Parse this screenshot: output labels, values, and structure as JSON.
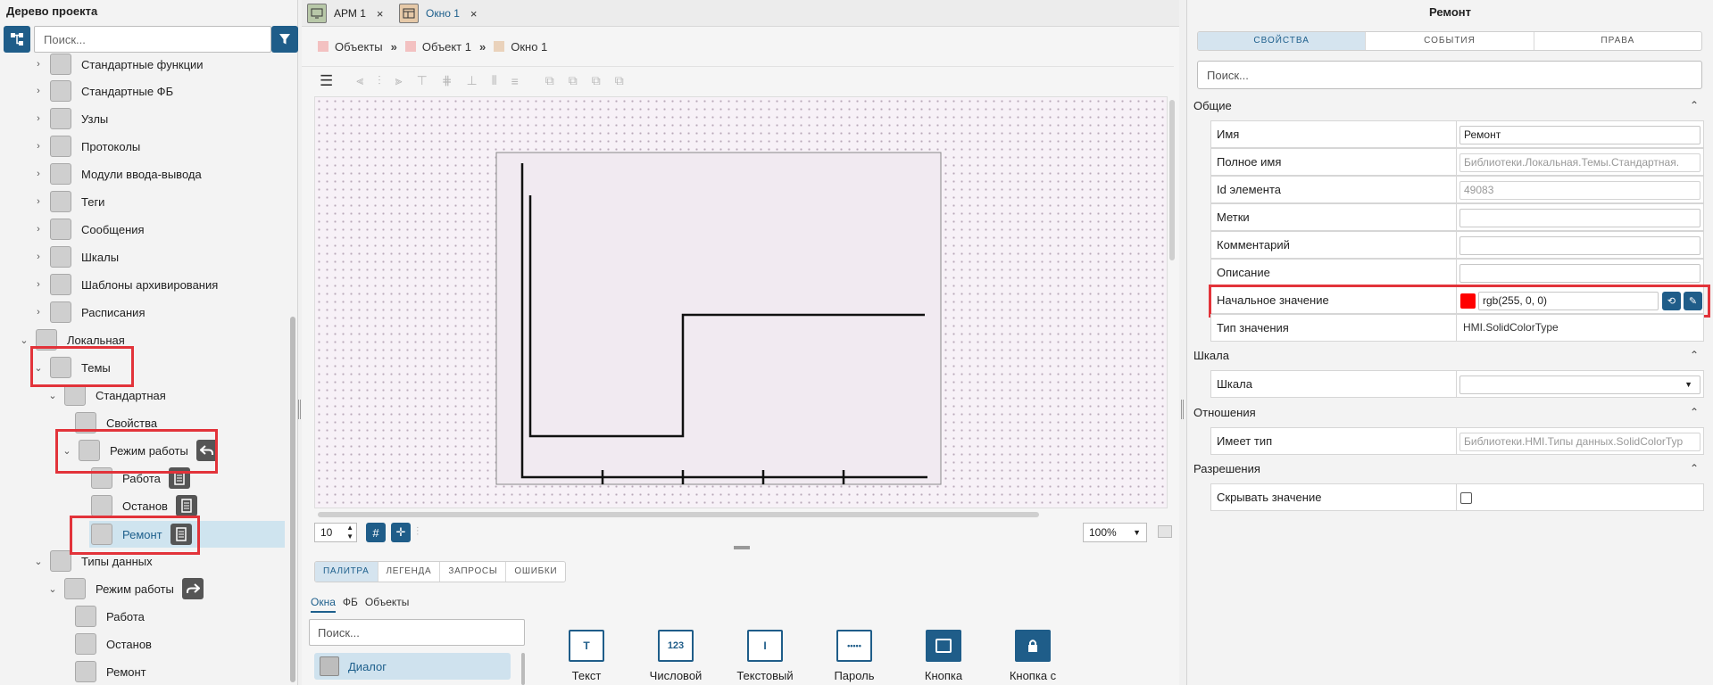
{
  "left": {
    "title": "Дерево проекта",
    "search_placeholder": "Поиск...",
    "tree": [
      {
        "label": "Стандартные функции"
      },
      {
        "label": "Стандартные ФБ"
      },
      {
        "label": "Узлы"
      },
      {
        "label": "Протоколы"
      },
      {
        "label": "Модули ввода-вывода"
      },
      {
        "label": "Теги"
      },
      {
        "label": "Сообщения"
      },
      {
        "label": "Шкалы"
      },
      {
        "label": "Шаблоны архивирования"
      },
      {
        "label": "Расписания"
      },
      {
        "label": "Локальная"
      },
      {
        "label": "Темы"
      },
      {
        "label": "Стандартная"
      },
      {
        "label": "Свойства"
      },
      {
        "label": "Режим работы"
      },
      {
        "label": "Работа"
      },
      {
        "label": "Останов"
      },
      {
        "label": "Ремонт"
      },
      {
        "label": "Типы данных"
      },
      {
        "label": "Режим работы"
      },
      {
        "label": "Работа"
      },
      {
        "label": "Останов"
      },
      {
        "label": "Ремонт"
      }
    ]
  },
  "center": {
    "tabs": [
      {
        "label": "АРМ 1",
        "close": "×"
      },
      {
        "label": "Окно 1",
        "close": "×"
      }
    ],
    "breadcrumb": {
      "items": [
        "Объекты",
        "Объект 1",
        "Окно 1"
      ],
      "separator": "»"
    },
    "grid_size": "10",
    "zoom": "100%",
    "panel_tabs": [
      "ПАЛИТРА",
      "ЛЕГЕНДА",
      "ЗАПРОСЫ",
      "ОШИБКИ"
    ],
    "sub_tabs": [
      "Окна",
      "ФБ",
      "Объекты"
    ],
    "palette_search_placeholder": "Поиск...",
    "palette_list_item": "Диалог",
    "palette_items": [
      {
        "label": "Текст",
        "icon": "T"
      },
      {
        "label": "Числовой",
        "icon": "123"
      },
      {
        "label": "Текстовый",
        "icon": "I"
      },
      {
        "label": "Пароль",
        "icon": "•••••"
      },
      {
        "label": "Кнопка",
        "icon": ""
      },
      {
        "label": "Кнопка с",
        "icon": "lock"
      }
    ]
  },
  "right": {
    "title": "Ремонт",
    "tabs": [
      "СВОЙСТВА",
      "СОБЫТИЯ",
      "ПРАВА"
    ],
    "search_placeholder": "Поиск...",
    "sections": {
      "general": "Общие",
      "scale": "Шкала",
      "relations": "Отношения",
      "permissions": "Разрешения"
    },
    "props": {
      "name": {
        "label": "Имя",
        "value": "Ремонт"
      },
      "fullname": {
        "label": "Полное имя",
        "value": "Библиотеки.Локальная.Темы.Стандартная."
      },
      "id": {
        "label": "Id элемента",
        "value": "49083"
      },
      "tags": {
        "label": "Метки",
        "value": ""
      },
      "comment": {
        "label": "Комментарий",
        "value": ""
      },
      "description": {
        "label": "Описание",
        "value": ""
      },
      "initial": {
        "label": "Начальное значение",
        "value": "rgb(255, 0, 0)",
        "color": "#ff0000"
      },
      "valtype": {
        "label": "Тип значения",
        "value": "HMI.SolidColorType"
      },
      "scale": {
        "label": "Шкала",
        "value": ""
      },
      "hastype": {
        "label": "Имеет тип",
        "value": "Библиотеки.HMI.Типы данных.SolidColorTyp"
      },
      "hide": {
        "label": "Скрывать значение",
        "checked": false
      }
    }
  },
  "colors": {
    "accent": "#1f5d89",
    "highlight": "#e2333a",
    "selected": "#cfe4ef"
  }
}
